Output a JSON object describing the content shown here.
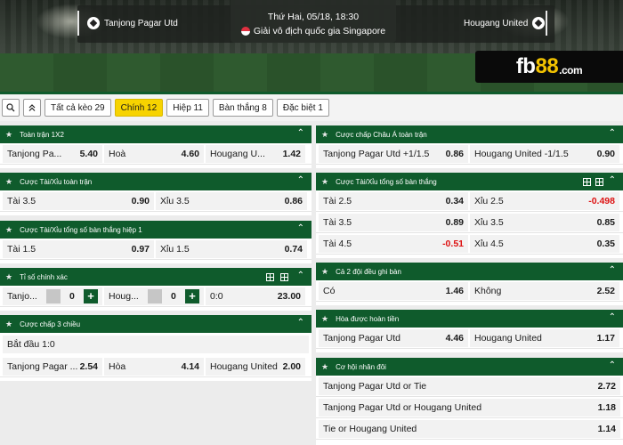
{
  "header": {
    "home_team": "Tanjong Pagar Utd",
    "away_team": "Hougang United",
    "date": "Thứ Hai, 05/18, 18:30",
    "league": "Giải vô địch quốc gia Singapore",
    "logo_fb": "fb",
    "logo_88": "88",
    "logo_com": ".com"
  },
  "filters": {
    "search_icon": "search-icon",
    "collapse_icon": "double-chevron-up-icon",
    "items": [
      "Tất cả kèo 29",
      "Chính 12",
      "Hiệp 11",
      "Bàn thắng 8",
      "Đặc biệt 1"
    ],
    "active_index": 1
  },
  "colors": {
    "brand_green": "#0f5b2c",
    "active_yellow": "#f7d300",
    "negative": "#d11111"
  },
  "left": {
    "s1": {
      "title": "Toàn trận 1X2",
      "home": "Tanjong Pa...",
      "home_odd": "5.40",
      "draw": "Hoà",
      "draw_odd": "4.60",
      "away": "Hougang U...",
      "away_odd": "1.42"
    },
    "s2": {
      "title": "Cược Tài/Xỉu toàn trận",
      "over": "Tài 3.5",
      "over_odd": "0.90",
      "under": "Xỉu 3.5",
      "under_odd": "0.86"
    },
    "s3": {
      "title": "Cược Tài/Xỉu tổng số bàn thắng hiệp 1",
      "over": "Tài 1.5",
      "over_odd": "0.97",
      "under": "Xỉu 1.5",
      "under_odd": "0.74"
    },
    "s4": {
      "title": "Tỉ số chính xác",
      "home": "Tanjo...",
      "home_score": "0",
      "away": "Houg...",
      "away_score": "0",
      "score": "0:0",
      "score_odd": "23.00"
    },
    "s5": {
      "title": "Cược chấp 3 chiều",
      "start": "Bắt đầu 1:0",
      "home": "Tanjong Pagar ...",
      "home_odd": "2.54",
      "draw": "Hòa",
      "draw_odd": "4.14",
      "away": "Hougang United",
      "away_odd": "2.00"
    }
  },
  "right": {
    "r1": {
      "title": "Cược chấp Châu Á toàn trận",
      "home": "Tanjong Pagar Utd +1/1.5",
      "home_odd": "0.86",
      "away": "Hougang United -1/1.5",
      "away_odd": "0.90"
    },
    "r2": {
      "title": "Cược Tài/Xỉu tổng số bàn thắng",
      "rows": [
        {
          "over": "Tài 2.5",
          "over_odd": "0.34",
          "under": "Xỉu 2.5",
          "under_odd": "-0.498"
        },
        {
          "over": "Tài 3.5",
          "over_odd": "0.89",
          "under": "Xỉu 3.5",
          "under_odd": "0.85"
        },
        {
          "over": "Tài 4.5",
          "over_odd": "-0.51",
          "under": "Xỉu 4.5",
          "under_odd": "0.35"
        }
      ]
    },
    "r3": {
      "title": "Cả 2 đội đều ghi bàn",
      "yes": "Có",
      "yes_odd": "1.46",
      "no": "Không",
      "no_odd": "2.52"
    },
    "r4": {
      "title": "Hòa được hoàn tiền",
      "home": "Tanjong Pagar Utd",
      "home_odd": "4.46",
      "away": "Hougang United",
      "away_odd": "1.17"
    },
    "r5": {
      "title": "Cơ hội nhân đôi",
      "rows": [
        {
          "label": "Tanjong Pagar Utd or Tie",
          "odd": "2.72"
        },
        {
          "label": "Tanjong Pagar Utd or Hougang United",
          "odd": "1.18"
        },
        {
          "label": "Tie or Hougang United",
          "odd": "1.14"
        }
      ]
    }
  }
}
